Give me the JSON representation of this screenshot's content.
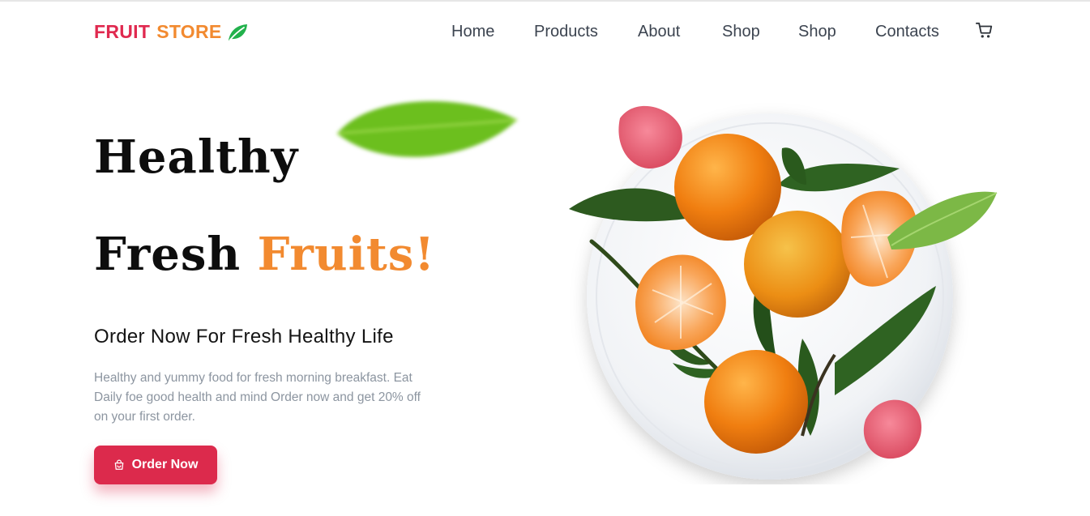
{
  "brand": {
    "word1": "FRUIT",
    "word2": "STORE",
    "icon": "leaf-icon"
  },
  "nav": {
    "items": [
      "Home",
      "Products",
      "About",
      "Shop",
      "Shop",
      "Contacts"
    ],
    "cart_icon": "cart-icon"
  },
  "hero": {
    "title_line1": "Healthy",
    "title_line2_plain": "Fresh",
    "title_line2_accent": "Fruits!",
    "subtitle": "Order Now For Fresh Healthy Life",
    "description": "Healthy and yummy food for fresh morning breakfast. Eat Daily foe good health and mind Order now and get 20% off on your first order.",
    "button_label": "Order Now",
    "button_icon": "shopping-bag-icon"
  },
  "colors": {
    "brand_red": "#e0294f",
    "brand_orange": "#f28a30",
    "brand_green": "#22b14c",
    "button": "#dc2a4c",
    "text_muted": "#8c95a0"
  }
}
